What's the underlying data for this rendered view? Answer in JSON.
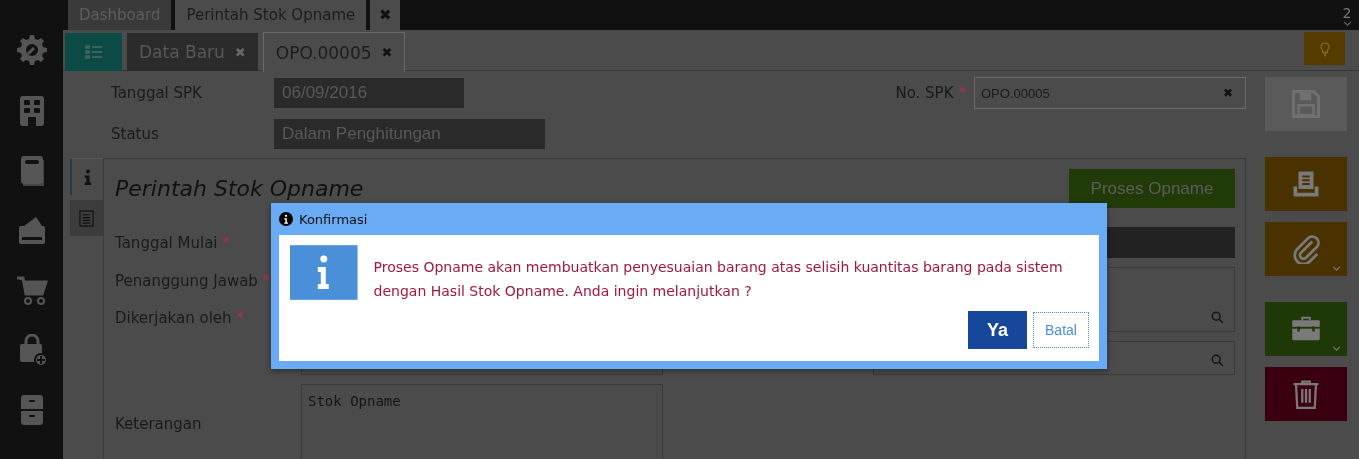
{
  "top_tabs": [
    {
      "label": "Dashboard",
      "selected": false
    },
    {
      "label": "Perintah Stok Opname",
      "selected": true
    }
  ],
  "top_close": "✖",
  "window_count": "2",
  "sidebar": [
    {
      "kind": "settings"
    },
    {
      "kind": "building"
    },
    {
      "kind": "book"
    },
    {
      "kind": "wallet"
    },
    {
      "kind": "cart"
    },
    {
      "kind": "bag"
    },
    {
      "kind": "cabinet"
    }
  ],
  "sub_tabs": [
    {
      "label": "Data Baru",
      "close": "✖",
      "selected": false
    },
    {
      "label": "OPO.00005",
      "close": "✖",
      "selected": true
    }
  ],
  "header_fields": [
    {
      "label": "Tanggal SPK",
      "value": "06/09/2016"
    },
    {
      "label": "Status",
      "value": "Dalam Penghitungan"
    }
  ],
  "spk": {
    "label": "No. SPK",
    "mark": "*",
    "value": "OPO.00005",
    "clear": "✖"
  },
  "side_tabs": [
    {
      "kind": "info",
      "selected": true
    },
    {
      "kind": "list",
      "selected": false
    }
  ],
  "panel": {
    "title": "Perintah Stok Opname",
    "action": "Proses Opname",
    "fields": [
      {
        "label": "Tanggal Mulai",
        "mark": "*"
      },
      {
        "label": "Penanggung Jawab",
        "mark": "*"
      },
      {
        "label": "Dikerjakan oleh",
        "mark": "*"
      },
      {
        "label": "Keterangan",
        "value": "Stok Opname"
      }
    ]
  },
  "actions": [
    {
      "kind": "save",
      "menu": false
    },
    {
      "kind": "print",
      "menu": false
    },
    {
      "kind": "attach",
      "menu": true
    },
    {
      "kind": "toolbox",
      "menu": true
    },
    {
      "kind": "delete",
      "menu": false
    }
  ],
  "dialog": {
    "title": "Konfirmasi",
    "message": "Proses Opname akan membuatkan penyesuaian barang atas selisih kuantitas barang pada sistem dengan Hasil Stok Opname. Anda ingin melanjutkan ?",
    "buttons": [
      {
        "label": "Ya",
        "kind": "primary"
      },
      {
        "label": "Batal",
        "kind": "secondary"
      }
    ]
  }
}
